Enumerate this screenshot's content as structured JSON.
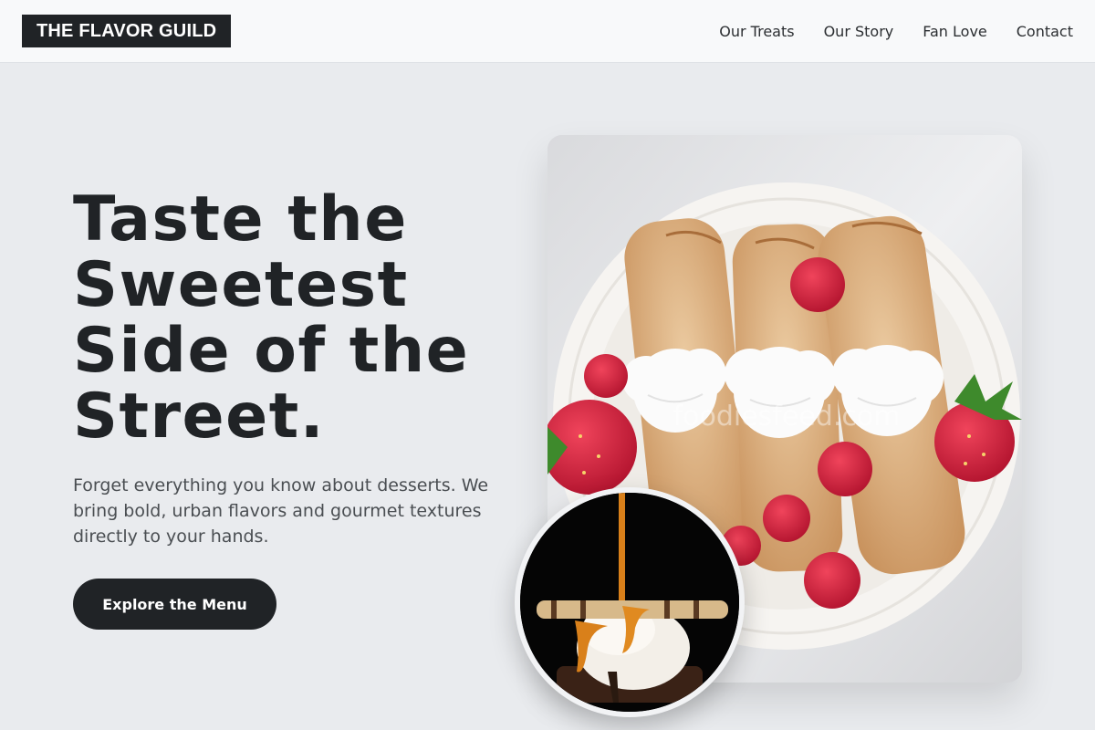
{
  "header": {
    "logo": "THE FLAVOR GUILD",
    "nav": [
      {
        "label": "Our Treats"
      },
      {
        "label": "Our Story"
      },
      {
        "label": "Fan Love"
      },
      {
        "label": "Contact"
      }
    ]
  },
  "hero": {
    "title": "Taste the Sweetest Side of the Street.",
    "subtitle": "Forget everything you know about desserts. We bring bold, urban flavors and gourmet textures directly to your hands.",
    "cta_label": "Explore the Menu"
  },
  "images": {
    "main_watermark": "foodiesfeed.com"
  },
  "colors": {
    "background": "#e9ebee",
    "header_bg": "#f8f9fa",
    "primary_dark": "#202326",
    "text_muted": "#4a4e52"
  }
}
